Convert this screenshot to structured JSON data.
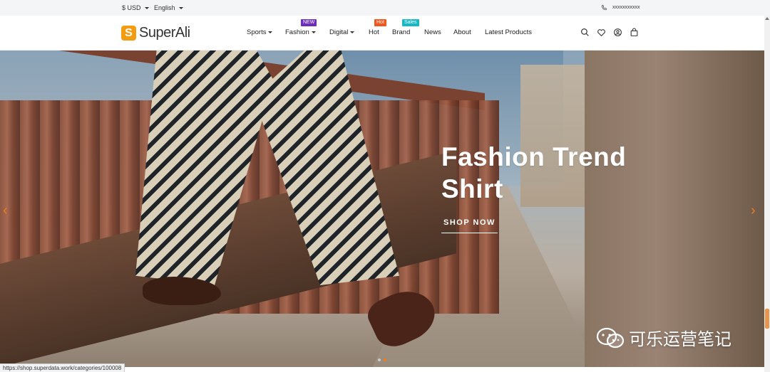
{
  "topbar": {
    "currency": "$ USD",
    "language": "English",
    "phone": "xxxxxxxxxxx"
  },
  "header": {
    "logo_mark": "S",
    "logo_text": "SuperAli",
    "nav": [
      {
        "label": "Sports",
        "dropdown": true
      },
      {
        "label": "Fashion",
        "dropdown": true,
        "badge": "NEW",
        "badge_color": "#6c2eb9"
      },
      {
        "label": "Digital",
        "dropdown": true
      },
      {
        "label": "Hot",
        "badge": "Hot",
        "badge_color": "#f0561d"
      },
      {
        "label": "Brand",
        "badge": "Sales",
        "badge_color": "#16b8c6"
      },
      {
        "label": "News"
      },
      {
        "label": "About"
      },
      {
        "label": "Latest Products"
      }
    ],
    "icons": [
      "search-icon",
      "heart-icon",
      "user-icon",
      "bag-icon"
    ]
  },
  "hero": {
    "title_line1": "Fashion Trend",
    "title_line2": "Shirt",
    "cta": "SHOP NOW",
    "accent": "#e67e22",
    "slides_total": 2,
    "active_slide": 2
  },
  "watermark": "可乐运营笔记",
  "status_url": "https://shop.superdata.work/categories/100008"
}
